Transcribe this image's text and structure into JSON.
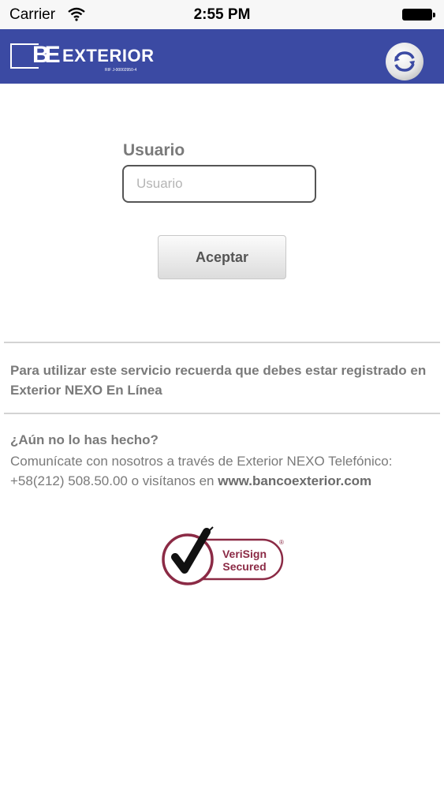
{
  "status_bar": {
    "carrier": "Carrier",
    "time": "2:55 PM"
  },
  "header": {
    "logo_mark": "BE",
    "logo_name": "EXTERIOR",
    "logo_rif": "RIF J-00002950-4",
    "refresh_icon": "refresh-icon",
    "color": "#3b4aa3"
  },
  "form": {
    "user_label": "Usuario",
    "user_placeholder": "Usuario",
    "accept_label": "Aceptar"
  },
  "notice": "Para utilizar este servicio recuerda que debes estar registrado en Exterior NEXO En Línea",
  "help": {
    "title": "¿Aún no lo has hecho?",
    "body_text": "Comunícate con nosotros a través de Exterior NEXO Telefónico: +58(212) 508.50.00 o visítanos en ",
    "link": "www.bancoexterior.com"
  },
  "seal": {
    "line1": "VeriSign",
    "line2": "Secured",
    "mark": "®"
  }
}
